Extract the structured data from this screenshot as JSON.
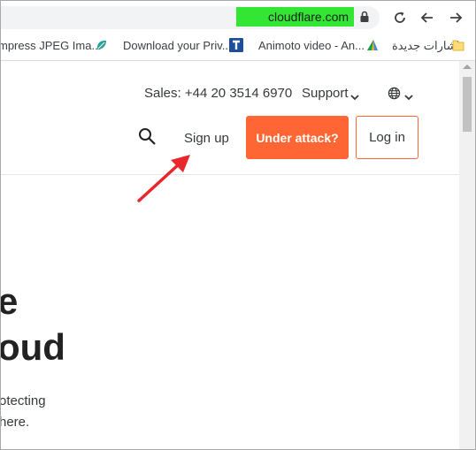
{
  "browser": {
    "url": "cloudflare.com",
    "colors": {
      "url_highlight": "#33e633"
    },
    "bookmarks": [
      {
        "label": "mpress JPEG Ima...",
        "icon": "leaf-icon"
      },
      {
        "label": "Download your Priv...",
        "icon": "t-square-icon"
      },
      {
        "label": "Animoto video - An...",
        "icon": "gradient-triangle-icon"
      },
      {
        "label": "اشارات جديدة",
        "icon": "folder-icon"
      }
    ]
  },
  "header": {
    "sales": "Sales: +44 20 3514 6970",
    "support": "Support",
    "sign_up": "Sign up",
    "under_attack": "Under attack?",
    "log_in": "Log in",
    "colors": {
      "accent": "#ff6633"
    }
  },
  "hero": {
    "line1": "e",
    "line2": "oud",
    "para1": "otecting",
    "para2": "here."
  },
  "annotation": {
    "color": "#e8262b",
    "icon": "red-arrow-icon"
  }
}
